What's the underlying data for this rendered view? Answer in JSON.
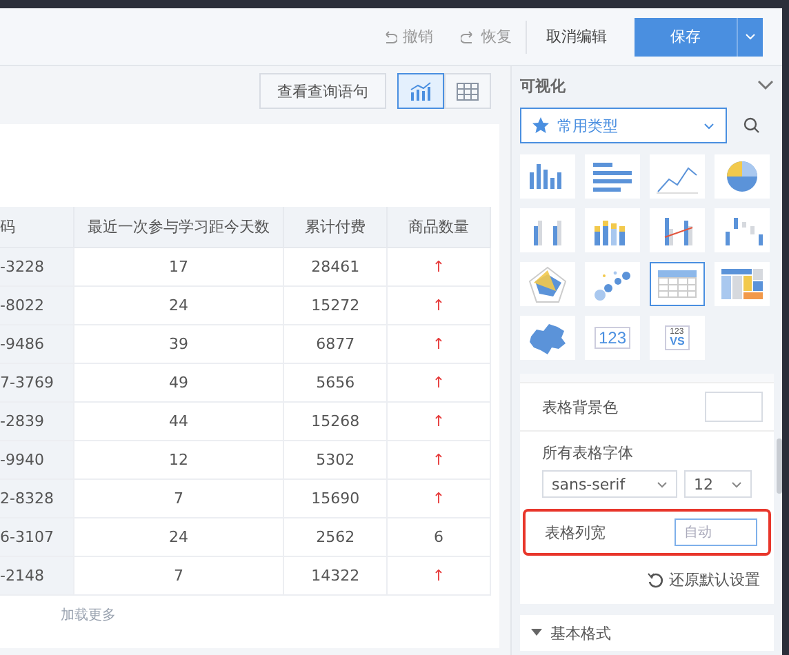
{
  "toolbar": {
    "undo": "撤销",
    "redo": "恢复",
    "cancel": "取消编辑",
    "save": "保存"
  },
  "view_bar": {
    "query_button": "查看查询语句",
    "views": [
      {
        "kind": "chart",
        "selected": true
      },
      {
        "kind": "table",
        "selected": false
      }
    ]
  },
  "table": {
    "columns": [
      "码",
      "最近一次参与学习距今天数",
      "累计付费",
      "商品数量"
    ],
    "rows": [
      {
        "cells": [
          "-3228",
          "17",
          "28461"
        ],
        "goods": {
          "text": "↑",
          "kind": "arrow"
        }
      },
      {
        "cells": [
          "-8022",
          "24",
          "15272"
        ],
        "goods": {
          "text": "↑",
          "kind": "arrow"
        }
      },
      {
        "cells": [
          "-9486",
          "39",
          "6877"
        ],
        "goods": {
          "text": "↑",
          "kind": "arrow"
        }
      },
      {
        "cells": [
          "7-3769",
          "49",
          "5656"
        ],
        "goods": {
          "text": "↑",
          "kind": "arrow"
        }
      },
      {
        "cells": [
          "-2839",
          "44",
          "15268"
        ],
        "goods": {
          "text": "↑",
          "kind": "arrow"
        }
      },
      {
        "cells": [
          "-9940",
          "12",
          "5302"
        ],
        "goods": {
          "text": "↑",
          "kind": "arrow"
        }
      },
      {
        "cells": [
          "2-8328",
          "7",
          "15690"
        ],
        "goods": {
          "text": "↑",
          "kind": "arrow"
        }
      },
      {
        "cells": [
          "6-3107",
          "24",
          "2562"
        ],
        "goods": {
          "text": "6",
          "kind": "number"
        }
      },
      {
        "cells": [
          "-2148",
          "7",
          "14322"
        ],
        "goods": {
          "text": "↑",
          "kind": "arrow"
        }
      }
    ],
    "load_more": "加载更多"
  },
  "visualization": {
    "title": "可视化",
    "category": "常用类型",
    "chart_types": [
      {
        "kind": "bar",
        "selected": false
      },
      {
        "kind": "hbar",
        "selected": false
      },
      {
        "kind": "line",
        "selected": false
      },
      {
        "kind": "pie",
        "selected": false
      },
      {
        "kind": "group",
        "selected": false
      },
      {
        "kind": "stack",
        "selected": false
      },
      {
        "kind": "combo",
        "selected": false
      },
      {
        "kind": "waterfall",
        "selected": false
      },
      {
        "kind": "radar",
        "selected": false
      },
      {
        "kind": "scatter",
        "selected": false
      },
      {
        "kind": "table",
        "selected": true
      },
      {
        "kind": "treemap",
        "selected": false
      },
      {
        "kind": "map",
        "selected": false
      },
      {
        "kind": "number",
        "selected": false,
        "label": "123"
      },
      {
        "kind": "compare",
        "selected": false,
        "label": "123",
        "sublabel": "VS"
      }
    ]
  },
  "settings": {
    "background_label": "表格背景色",
    "font_label": "所有表格字体",
    "font_family": "sans-serif",
    "font_size": "12",
    "width_label": "表格列宽",
    "width_placeholder": "自动",
    "reset": "还原默认设置",
    "section": "基本格式",
    "section_expanded": true
  }
}
